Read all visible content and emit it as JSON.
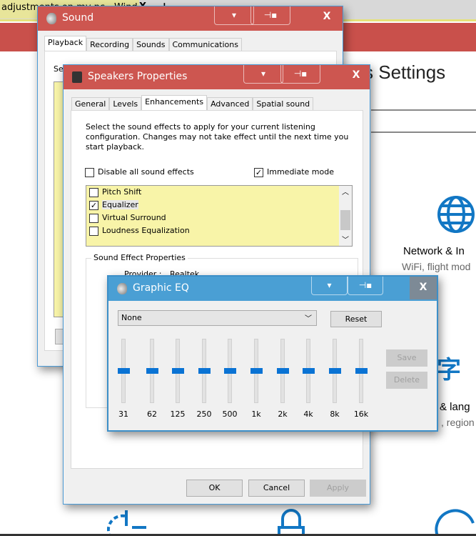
{
  "browser": {
    "tab_title": "adjustments on my pc - Wind",
    "tab_close": "X",
    "new_tab": "+"
  },
  "settings": {
    "title": "s Settings",
    "network": {
      "title": "Network & In",
      "subtitle": "WiFi, flight mod"
    },
    "language": {
      "title": "& lang",
      "subtitle": ", region"
    }
  },
  "sound": {
    "title": "Sound",
    "tabs": [
      "Playback",
      "Recording",
      "Sounds",
      "Communications"
    ],
    "active_tab": "Playback",
    "partial_text": "Se"
  },
  "speakers": {
    "title": "Speakers Properties",
    "tabs": [
      "General",
      "Levels",
      "Enhancements",
      "Advanced",
      "Spatial sound"
    ],
    "active_tab": "Enhancements",
    "description": "Select the sound effects to apply for your current listening configuration. Changes may not take effect until the next time you start playback.",
    "disable_all": {
      "label": "Disable all sound effects",
      "checked": false
    },
    "immediate": {
      "label": "Immediate mode",
      "checked": true
    },
    "effects": [
      {
        "label": "Pitch Shift",
        "checked": false
      },
      {
        "label": "Equalizer",
        "checked": true
      },
      {
        "label": "Virtual Surround",
        "checked": false
      },
      {
        "label": "Loudness Equalization",
        "checked": false
      }
    ],
    "group_title": "Sound Effect Properties",
    "provider_label": "Provider :",
    "provider_value": "Realtek",
    "buttons": {
      "ok": "OK",
      "cancel": "Cancel",
      "apply": "Apply"
    }
  },
  "eq": {
    "title": "Graphic EQ",
    "preset": "None",
    "reset": "Reset",
    "save": "Save",
    "delete": "Delete",
    "bands": [
      "31",
      "62",
      "125",
      "250",
      "500",
      "1k",
      "2k",
      "4k",
      "8k",
      "16k"
    ],
    "levels_percent": [
      50,
      50,
      50,
      50,
      50,
      50,
      50,
      50,
      50,
      50
    ]
  },
  "title_buttons": {
    "minimize": "▾",
    "pin": "⊣▪",
    "close": "X"
  },
  "colors": {
    "red_titlebar": "#cd5650",
    "blue_titlebar": "#4a9fd4",
    "accent": "#0a73d4",
    "list_highlight": "#f8f4a8"
  }
}
